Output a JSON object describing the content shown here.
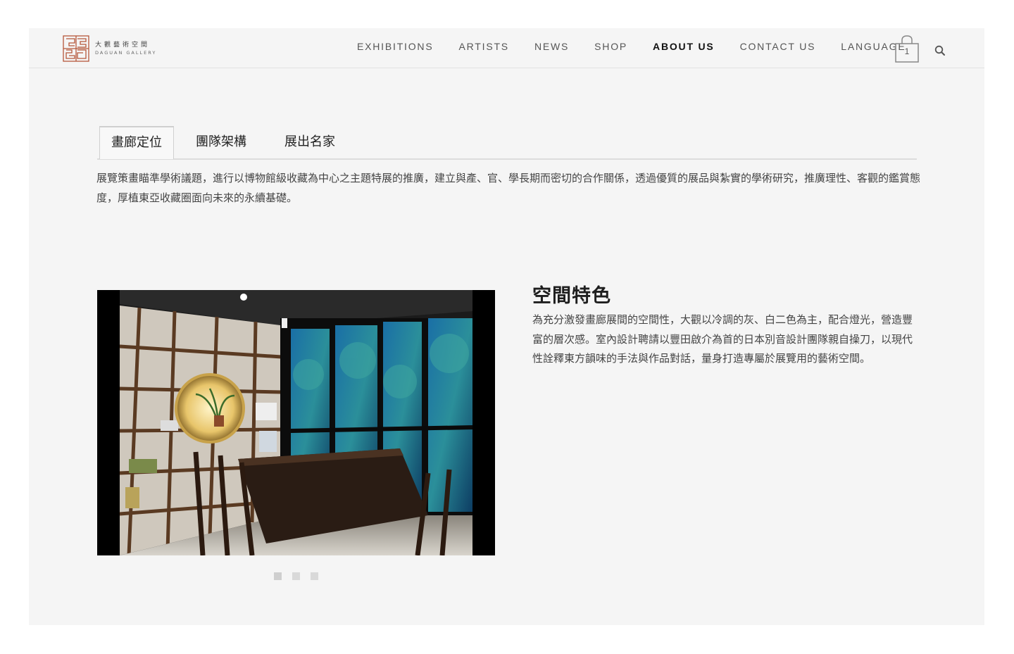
{
  "header": {
    "logo": {
      "cn": "大觀藝術空間",
      "en": "DAGUAN GALLERY",
      "brand_color": "#b5573a"
    },
    "nav": [
      {
        "label": "EXHIBITIONS",
        "active": false
      },
      {
        "label": "ARTISTS",
        "active": false
      },
      {
        "label": "NEWS",
        "active": false
      },
      {
        "label": "SHOP",
        "active": false
      },
      {
        "label": "ABOUT US",
        "active": true
      },
      {
        "label": "CONTACT US",
        "active": false
      },
      {
        "label": "LANGUAGE",
        "active": false
      }
    ],
    "cart_count": "1",
    "icons": {
      "cart": "shopping-bag-icon",
      "search": "search-icon"
    }
  },
  "tabs": [
    {
      "label": "畫廊定位",
      "active": true
    },
    {
      "label": "團隊架構",
      "active": false
    },
    {
      "label": "展出名家",
      "active": false
    }
  ],
  "intro": "展覽策畫瞄準學術議題，進行以博物館級收藏為中心之主題特展的推廣，建立與產、官、學長期而密切的合作關係，透過優質的展品與紮實的學術研究，推廣理性、客觀的鑑賞態度，厚植東亞收藏圈面向未來的永續基礎。",
  "space": {
    "title": "空間特色",
    "description": "為充分激發畫廊展間的空間性，大觀以冷調的灰、白二色為主，配合燈光，營造豐富的層次感。室內設計聘請以豐田啟介為首的日本別音設計團隊親自操刀，以現代性詮釋東方韻味的手法與作品對話，量身打造專屬於展覽用的藝術空間。"
  },
  "slider": {
    "count": 3,
    "active_index": 0
  }
}
